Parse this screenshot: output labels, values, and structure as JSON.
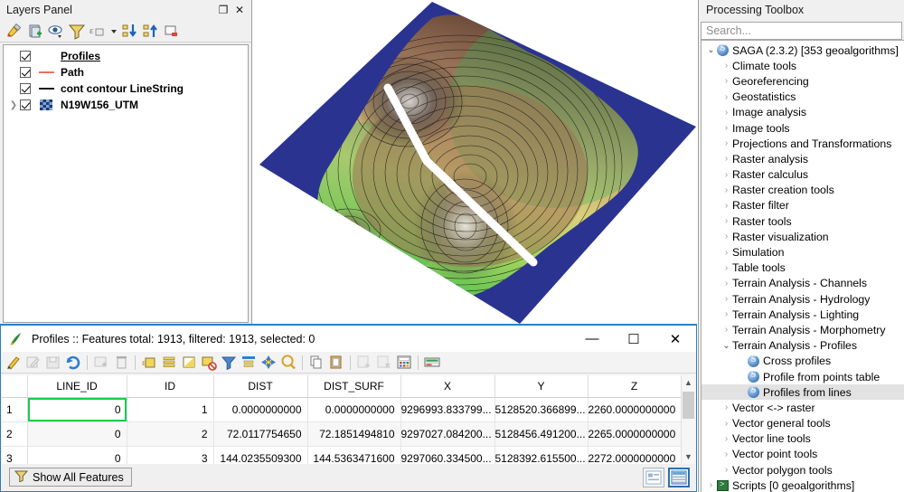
{
  "layers_panel": {
    "title": "Layers Panel",
    "undock_label": "❐",
    "close_label": "✕",
    "toolbar": [
      {
        "name": "open-layer-styling-panel-icon",
        "tip": "Open Layer Styling panel"
      },
      {
        "name": "add-group-icon",
        "tip": "Add Group"
      },
      {
        "name": "manage-layer-visibility-icon",
        "tip": "Manage Layer Visibility"
      },
      {
        "name": "filter-legend-icon",
        "tip": "Filter Legend"
      },
      {
        "name": "filter-legend-by-expression-icon",
        "tip": "Filter Legend by Expression"
      },
      {
        "name": "expression-dropdown-icon",
        "tip": "Expression options"
      },
      {
        "name": "expand-all-icon",
        "tip": "Expand All"
      },
      {
        "name": "collapse-all-icon",
        "tip": "Collapse All"
      },
      {
        "name": "remove-layer-icon",
        "tip": "Remove Layer/Group"
      }
    ],
    "layers": [
      {
        "label": "Profiles",
        "checked": true,
        "active": true,
        "symbol": "none",
        "expandable": false
      },
      {
        "label": "Path",
        "checked": true,
        "active": false,
        "symbol": "line",
        "symbol_color": "#ef6f5a",
        "expandable": false
      },
      {
        "label": "cont contour LineString",
        "checked": true,
        "active": false,
        "symbol": "line",
        "symbol_color": "#1a1a1a",
        "expandable": false
      },
      {
        "label": "N19W156_UTM",
        "checked": true,
        "active": false,
        "symbol": "raster",
        "expandable": true
      }
    ]
  },
  "map": {
    "name": "map-canvas",
    "background_color": "#ffffff",
    "nodata_color": "#2b3390",
    "profile_line_color": "#ffffff",
    "description": "Rotated DEM hillshade with green-to-brown elevation ramp and black contour lines; white profile path line crosses the raster diagonally."
  },
  "processing_toolbox": {
    "title": "Processing Toolbox",
    "search": {
      "placeholder": "Search...",
      "value": ""
    },
    "tree": [
      {
        "label": "SAGA (2.3.2) [353 geoalgorithms]",
        "depth": 0,
        "state": "expanded",
        "icon": "saga-provider-icon"
      },
      {
        "label": "Climate tools",
        "depth": 1,
        "state": "collapsed"
      },
      {
        "label": "Georeferencing",
        "depth": 1,
        "state": "collapsed"
      },
      {
        "label": "Geostatistics",
        "depth": 1,
        "state": "collapsed"
      },
      {
        "label": "Image analysis",
        "depth": 1,
        "state": "collapsed"
      },
      {
        "label": "Image tools",
        "depth": 1,
        "state": "collapsed"
      },
      {
        "label": "Projections and Transformations",
        "depth": 1,
        "state": "collapsed"
      },
      {
        "label": "Raster analysis",
        "depth": 1,
        "state": "collapsed"
      },
      {
        "label": "Raster calculus",
        "depth": 1,
        "state": "collapsed"
      },
      {
        "label": "Raster creation tools",
        "depth": 1,
        "state": "collapsed"
      },
      {
        "label": "Raster filter",
        "depth": 1,
        "state": "collapsed"
      },
      {
        "label": "Raster tools",
        "depth": 1,
        "state": "collapsed"
      },
      {
        "label": "Raster visualization",
        "depth": 1,
        "state": "collapsed"
      },
      {
        "label": "Simulation",
        "depth": 1,
        "state": "collapsed"
      },
      {
        "label": "Table tools",
        "depth": 1,
        "state": "collapsed"
      },
      {
        "label": "Terrain Analysis - Channels",
        "depth": 1,
        "state": "collapsed"
      },
      {
        "label": "Terrain Analysis - Hydrology",
        "depth": 1,
        "state": "collapsed"
      },
      {
        "label": "Terrain Analysis - Lighting",
        "depth": 1,
        "state": "collapsed"
      },
      {
        "label": "Terrain Analysis - Morphometry",
        "depth": 1,
        "state": "collapsed"
      },
      {
        "label": "Terrain Analysis - Profiles",
        "depth": 1,
        "state": "expanded"
      },
      {
        "label": "Cross profiles",
        "depth": 2,
        "state": "leaf",
        "icon": "saga-algorithm-icon"
      },
      {
        "label": "Profile from points table",
        "depth": 2,
        "state": "leaf",
        "icon": "saga-algorithm-icon"
      },
      {
        "label": "Profiles from lines",
        "depth": 2,
        "state": "leaf",
        "icon": "saga-algorithm-icon",
        "selected": true
      },
      {
        "label": "Vector <-> raster",
        "depth": 1,
        "state": "collapsed"
      },
      {
        "label": "Vector general tools",
        "depth": 1,
        "state": "collapsed"
      },
      {
        "label": "Vector line tools",
        "depth": 1,
        "state": "collapsed"
      },
      {
        "label": "Vector point tools",
        "depth": 1,
        "state": "collapsed"
      },
      {
        "label": "Vector polygon tools",
        "depth": 1,
        "state": "collapsed"
      },
      {
        "label": "Scripts [0 geoalgorithms]",
        "depth": 0,
        "state": "collapsed",
        "icon": "scripts-provider-icon"
      }
    ],
    "selection_color": "#e2e2e2"
  },
  "attribute_table": {
    "title": "Profiles :: Features total: 1913, filtered: 1913, selected: 0",
    "layer_name": "Profiles",
    "features_total": "1913",
    "features_filtered": "1913",
    "features_selected": "0",
    "window_buttons": {
      "minimize": "—",
      "maximize": "☐",
      "close": "✕"
    },
    "toolbar": [
      {
        "name": "toggle-editing-icon",
        "tip": "Toggle editing mode",
        "enabled": true
      },
      {
        "name": "multi-edit-icon",
        "tip": "Toggle multi edit mode",
        "enabled": false
      },
      {
        "name": "save-edits-icon",
        "tip": "Save edits",
        "enabled": false
      },
      {
        "name": "reload-table-icon",
        "tip": "Reload the table",
        "enabled": true
      },
      {
        "name": "sep"
      },
      {
        "name": "add-feature-icon",
        "tip": "Add feature",
        "enabled": false
      },
      {
        "name": "delete-selected-icon",
        "tip": "Delete selected features",
        "enabled": false
      },
      {
        "name": "sep"
      },
      {
        "name": "select-by-expression-icon",
        "tip": "Select features using an expression",
        "enabled": true
      },
      {
        "name": "select-all-icon",
        "tip": "Select all features",
        "enabled": true
      },
      {
        "name": "invert-selection-icon",
        "tip": "Invert selection",
        "enabled": true
      },
      {
        "name": "deselect-all-icon",
        "tip": "Deselect all features",
        "enabled": true
      },
      {
        "name": "filter-selection-icon",
        "tip": "Filter / select features",
        "enabled": true
      },
      {
        "name": "move-selection-to-top-icon",
        "tip": "Move selection to top",
        "enabled": true
      },
      {
        "name": "pan-to-selected-icon",
        "tip": "Pan map to the selected rows",
        "enabled": true
      },
      {
        "name": "zoom-to-selected-icon",
        "tip": "Zoom map to the selected rows",
        "enabled": true
      },
      {
        "name": "sep"
      },
      {
        "name": "copy-selected-icon",
        "tip": "Copy selected rows to clipboard",
        "enabled": true
      },
      {
        "name": "paste-features-icon",
        "tip": "Paste features from clipboard",
        "enabled": true
      },
      {
        "name": "sep"
      },
      {
        "name": "new-field-icon",
        "tip": "New field",
        "enabled": false
      },
      {
        "name": "delete-field-icon",
        "tip": "Delete field",
        "enabled": false
      },
      {
        "name": "open-field-calculator-icon",
        "tip": "Open field calculator",
        "enabled": true
      },
      {
        "name": "sep"
      },
      {
        "name": "conditional-formatting-icon",
        "tip": "Conditional formatting",
        "enabled": true
      }
    ],
    "columns": [
      "LINE_ID",
      "ID",
      "DIST",
      "DIST_SURF",
      "X",
      "Y",
      "Z"
    ],
    "rows": [
      {
        "num": "1",
        "cells": [
          "0",
          "1",
          "0.0000000000",
          "0.0000000000",
          "9296993.833799...",
          "5128520.366899...",
          "2260.0000000000"
        ],
        "selected_cell": 0
      },
      {
        "num": "2",
        "cells": [
          "0",
          "2",
          "72.0117754650",
          "72.1851494810",
          "9297027.084200...",
          "5128456.491200...",
          "2265.0000000000"
        ]
      },
      {
        "num": "3",
        "cells": [
          "0",
          "3",
          "144.0235509300",
          "144.5363471600",
          "9297060.334500...",
          "5128392.615500...",
          "2272.0000000000"
        ]
      }
    ],
    "status": {
      "show_all_features_label": "Show All Features",
      "table_view_tip": "Switch to table view",
      "form_view_tip": "Switch to form view",
      "active_view": "table"
    },
    "selection_border_color": "#17cc4a",
    "accent_color": "#2b7fc4"
  }
}
